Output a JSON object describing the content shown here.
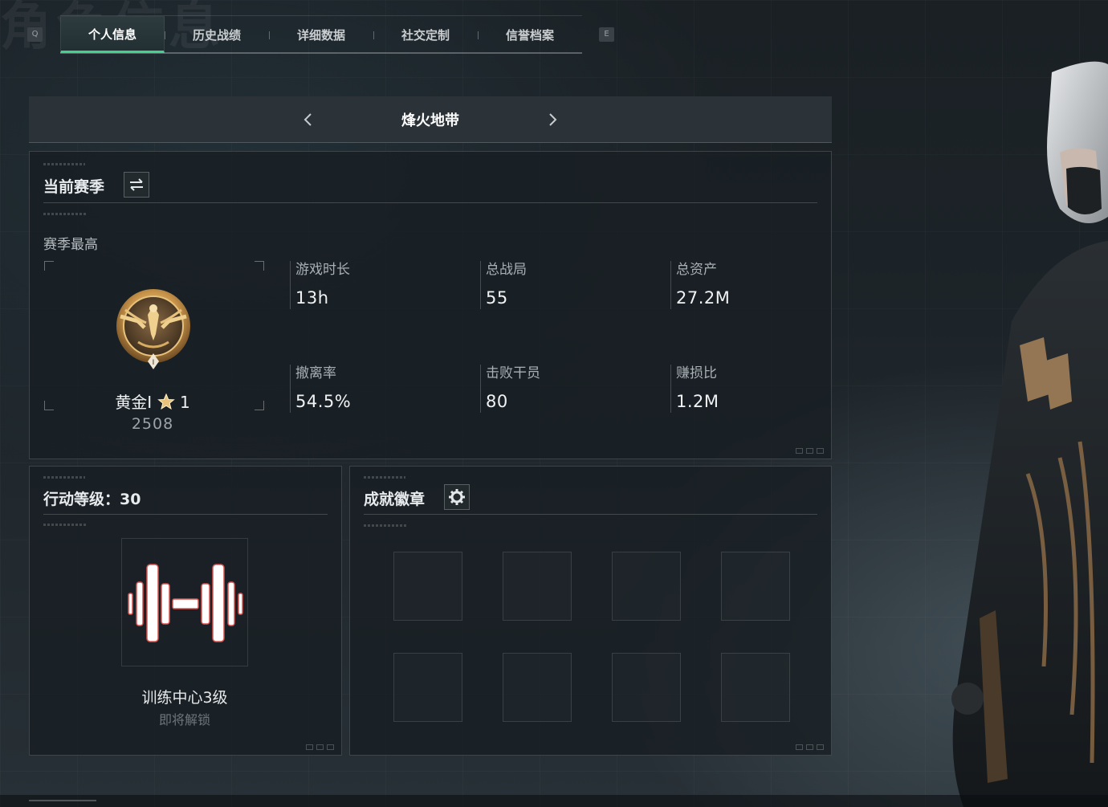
{
  "background": {
    "watermark_title": "角色信息"
  },
  "tabs": {
    "left_key": "Q",
    "right_key": "E",
    "items": [
      {
        "label": "个人信息",
        "active": true
      },
      {
        "label": "历史战绩",
        "active": false
      },
      {
        "label": "详细数据",
        "active": false
      },
      {
        "label": "社交定制",
        "active": false
      },
      {
        "label": "信誉档案",
        "active": false
      }
    ]
  },
  "mode_selector": {
    "title": "烽火地带",
    "prev_icon": "chevron-left-icon",
    "next_icon": "chevron-right-icon"
  },
  "season_panel": {
    "title": "当前赛季",
    "switch_icon": "swap-icon",
    "section_label": "赛季最高",
    "rank": {
      "name": "黄金I",
      "star_icon": "star-icon",
      "stars": "1",
      "score": "2508",
      "emblem_icon": "gold-eagle-emblem-icon",
      "emblem_tier": "I"
    },
    "stats": [
      {
        "label": "游戏时长",
        "value": "13h"
      },
      {
        "label": "总战局",
        "value": "55"
      },
      {
        "label": "总资产",
        "value": "27.2M"
      },
      {
        "label": "撤离率",
        "value": "54.5%"
      },
      {
        "label": "击败干员",
        "value": "80"
      },
      {
        "label": "赚损比",
        "value": "1.2M"
      }
    ]
  },
  "level_panel": {
    "title": "行动等级：30",
    "icon": "dumbbell-icon",
    "unlock_name": "训练中心3级",
    "unlock_status": "即将解锁"
  },
  "badge_panel": {
    "title": "成就徽章",
    "settings_icon": "gear-icon",
    "slot_count": 8
  },
  "colors": {
    "accent_green": "#3fd38e",
    "panel_bg": "#181f23",
    "gold": "#c8944a"
  }
}
